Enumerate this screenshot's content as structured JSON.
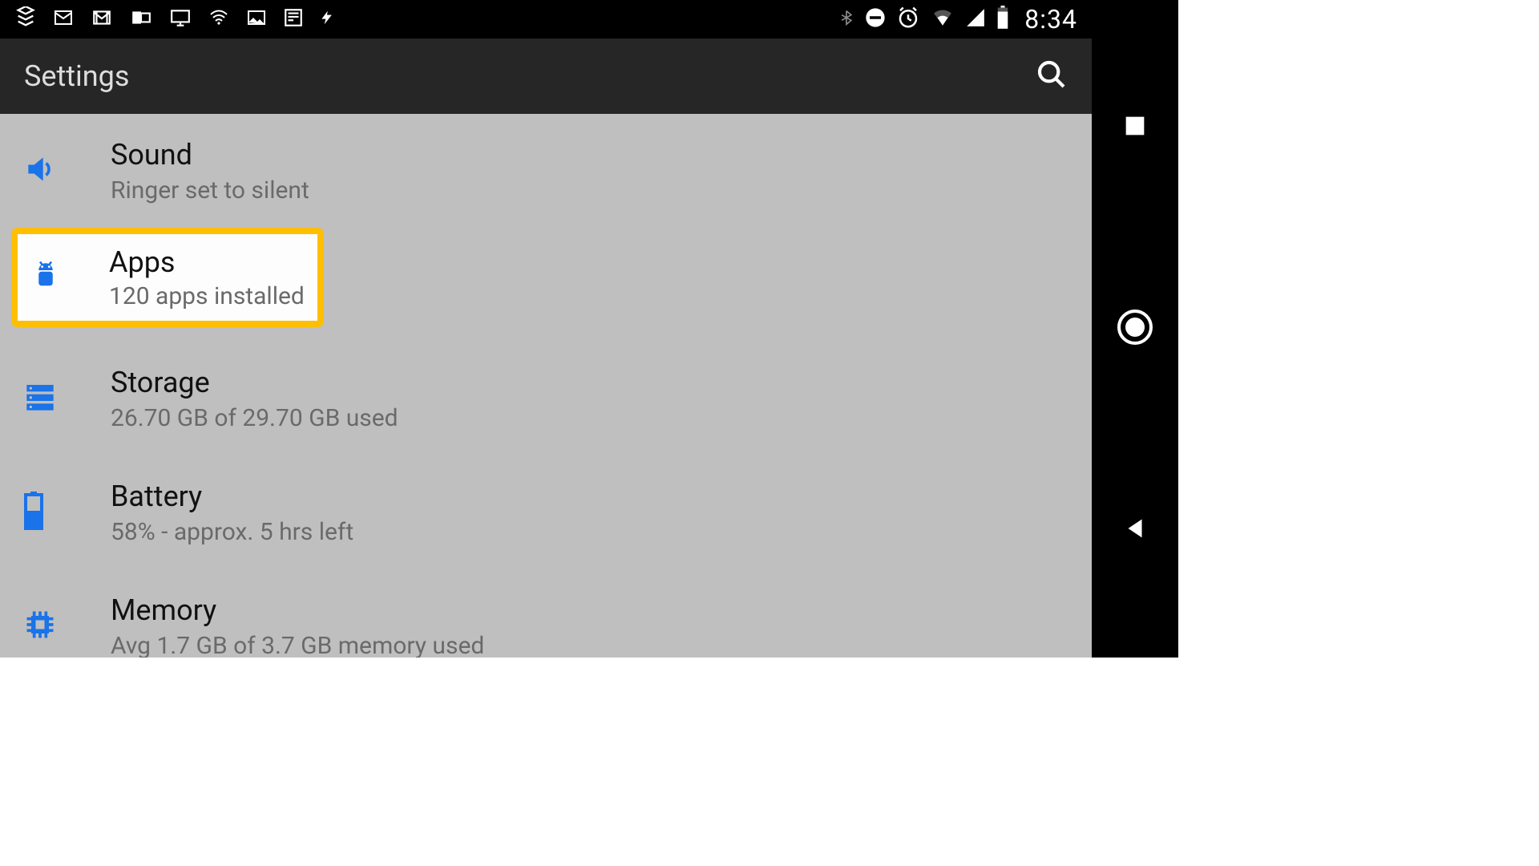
{
  "statusbar": {
    "clock": "8:34"
  },
  "appbar": {
    "title": "Settings"
  },
  "items": [
    {
      "title": "Sound",
      "subtitle": "Ringer set to silent"
    },
    {
      "title": "Apps",
      "subtitle": "120 apps installed"
    },
    {
      "title": "Storage",
      "subtitle": "26.70 GB of 29.70 GB used"
    },
    {
      "title": "Battery",
      "subtitle": "58% - approx. 5 hrs left"
    },
    {
      "title": "Memory",
      "subtitle": "Avg 1.7 GB of 3.7 GB memory used"
    }
  ]
}
